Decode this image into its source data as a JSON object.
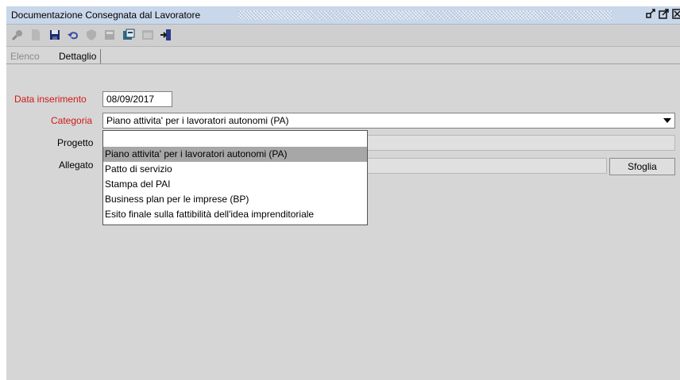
{
  "window": {
    "title": "Documentazione Consegnata dal Lavoratore",
    "controls": [
      "restore-icon",
      "maximize-icon",
      "close-icon"
    ]
  },
  "toolbar": {
    "tools": [
      "search-icon",
      "new-document-icon",
      "save-icon",
      "undo-icon",
      "shield-icon",
      "print-icon",
      "copy-icon",
      "calendar-icon",
      "exit-icon"
    ]
  },
  "tabs": [
    {
      "label": "Elenco",
      "active": false
    },
    {
      "label": "Dettaglio",
      "active": true
    }
  ],
  "form": {
    "data_inserimento": {
      "label": "Data inserimento",
      "value": "08/09/2017"
    },
    "categoria": {
      "label": "Categoria",
      "value": "Piano attivita' per i lavoratori autonomi (PA)"
    },
    "progetto": {
      "label": "Progetto",
      "value": ""
    },
    "allegato": {
      "label": "Allegato",
      "value": "",
      "button": "Sfoglia"
    }
  },
  "dropdown": {
    "options": [
      "",
      "Piano attivita' per i lavoratori autonomi (PA)",
      "Patto di servizio",
      "Stampa del PAI",
      "Business plan per le imprese (BP)",
      "Esito finale sulla fattibilità dell'idea imprenditoriale"
    ],
    "selected_index": 1
  },
  "colors": {
    "titlebar": "#c9d7ea",
    "panel": "#d6d6d6",
    "required_label": "#d01818",
    "selected_option": "#a7a7a7"
  }
}
